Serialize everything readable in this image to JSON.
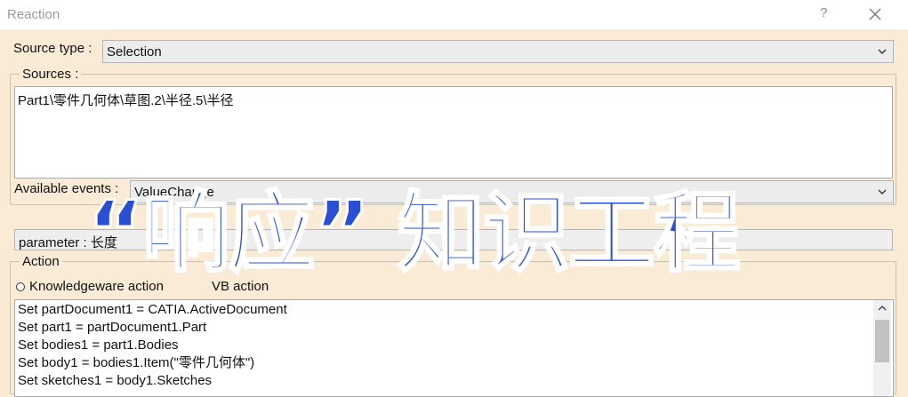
{
  "window": {
    "title": "Reaction",
    "help": "?"
  },
  "source_type": {
    "label": "Source type :",
    "value": "Selection"
  },
  "sources": {
    "group_label": "Sources :",
    "items": [
      "Part1\\零件几何体\\草图.2\\半径.5\\半径"
    ]
  },
  "events": {
    "label": "Available events :",
    "value": "ValueChange"
  },
  "parameter": {
    "text": "parameter : 长度"
  },
  "action": {
    "group_label": "Action",
    "radio_label": "Knowledgeware action",
    "radio2_label": "VB action",
    "code_lines": [
      "Set partDocument1 = CATIA.ActiveDocument",
      "Set part1 = partDocument1.Part",
      "Set bodies1 = part1.Bodies",
      "Set body1 = bodies1.Item(\"零件几何体\")",
      "Set sketches1 = body1.Sketches"
    ]
  },
  "overlay": {
    "text": "“响应” 知识工程"
  },
  "colors": {
    "background": "#faebd7",
    "overlay_text": "#2b4fd4"
  }
}
